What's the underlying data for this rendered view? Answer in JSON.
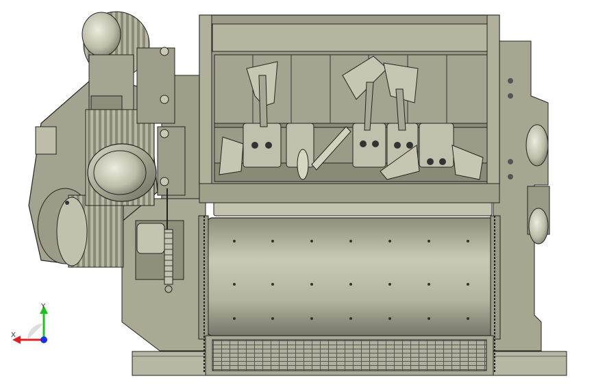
{
  "viewport": {
    "background": "#ffffff",
    "part": "twin-shaft-mixer-assembly",
    "body_color": "#a9a994",
    "shadow_color": "#7d7d6a",
    "edge_color": "#222222"
  },
  "triad": {
    "x_label": "X",
    "y_label": "Y",
    "x_color": "#e02020",
    "y_color": "#20c020",
    "z_color": "#2030e0"
  }
}
